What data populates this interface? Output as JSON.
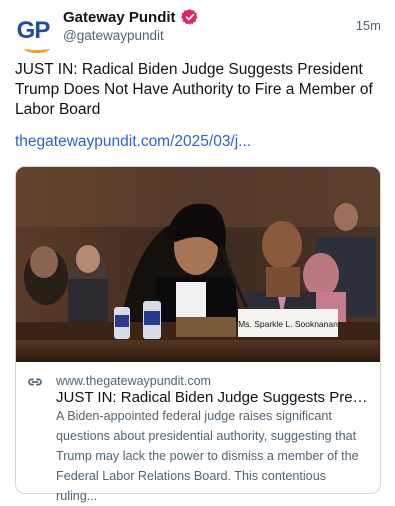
{
  "post": {
    "author_logo_text": "GP",
    "display_name": "Gateway Pundit",
    "handle": "@gatewaypundit",
    "timestamp": "15m",
    "text": "JUST IN: Radical Biden Judge Suggests President Trump Does Not Have Authority to Fire a Member of Labor Board",
    "link_text": "thegatewaypundit.com/2025/03/j..."
  },
  "card": {
    "domain": "www.thegatewaypundit.com",
    "title": "JUST IN: Radical Biden Judge Suggests Presid...",
    "description": "A Biden-appointed federal judge raises significant questions about presidential authority, suggesting that Trump may lack the power to dismiss a member of the Federal Labor Relations Board. This contentious ruling...",
    "image_nameplate": "Ms. Sparkle L. Sooknanan",
    "link_icon": "link-icon"
  },
  "colors": {
    "link": "#2a62d9",
    "verified": "#e0245e",
    "logo_blue": "#1f4da3",
    "logo_orange": "#f0a21b",
    "secondary_text": "#536471"
  }
}
